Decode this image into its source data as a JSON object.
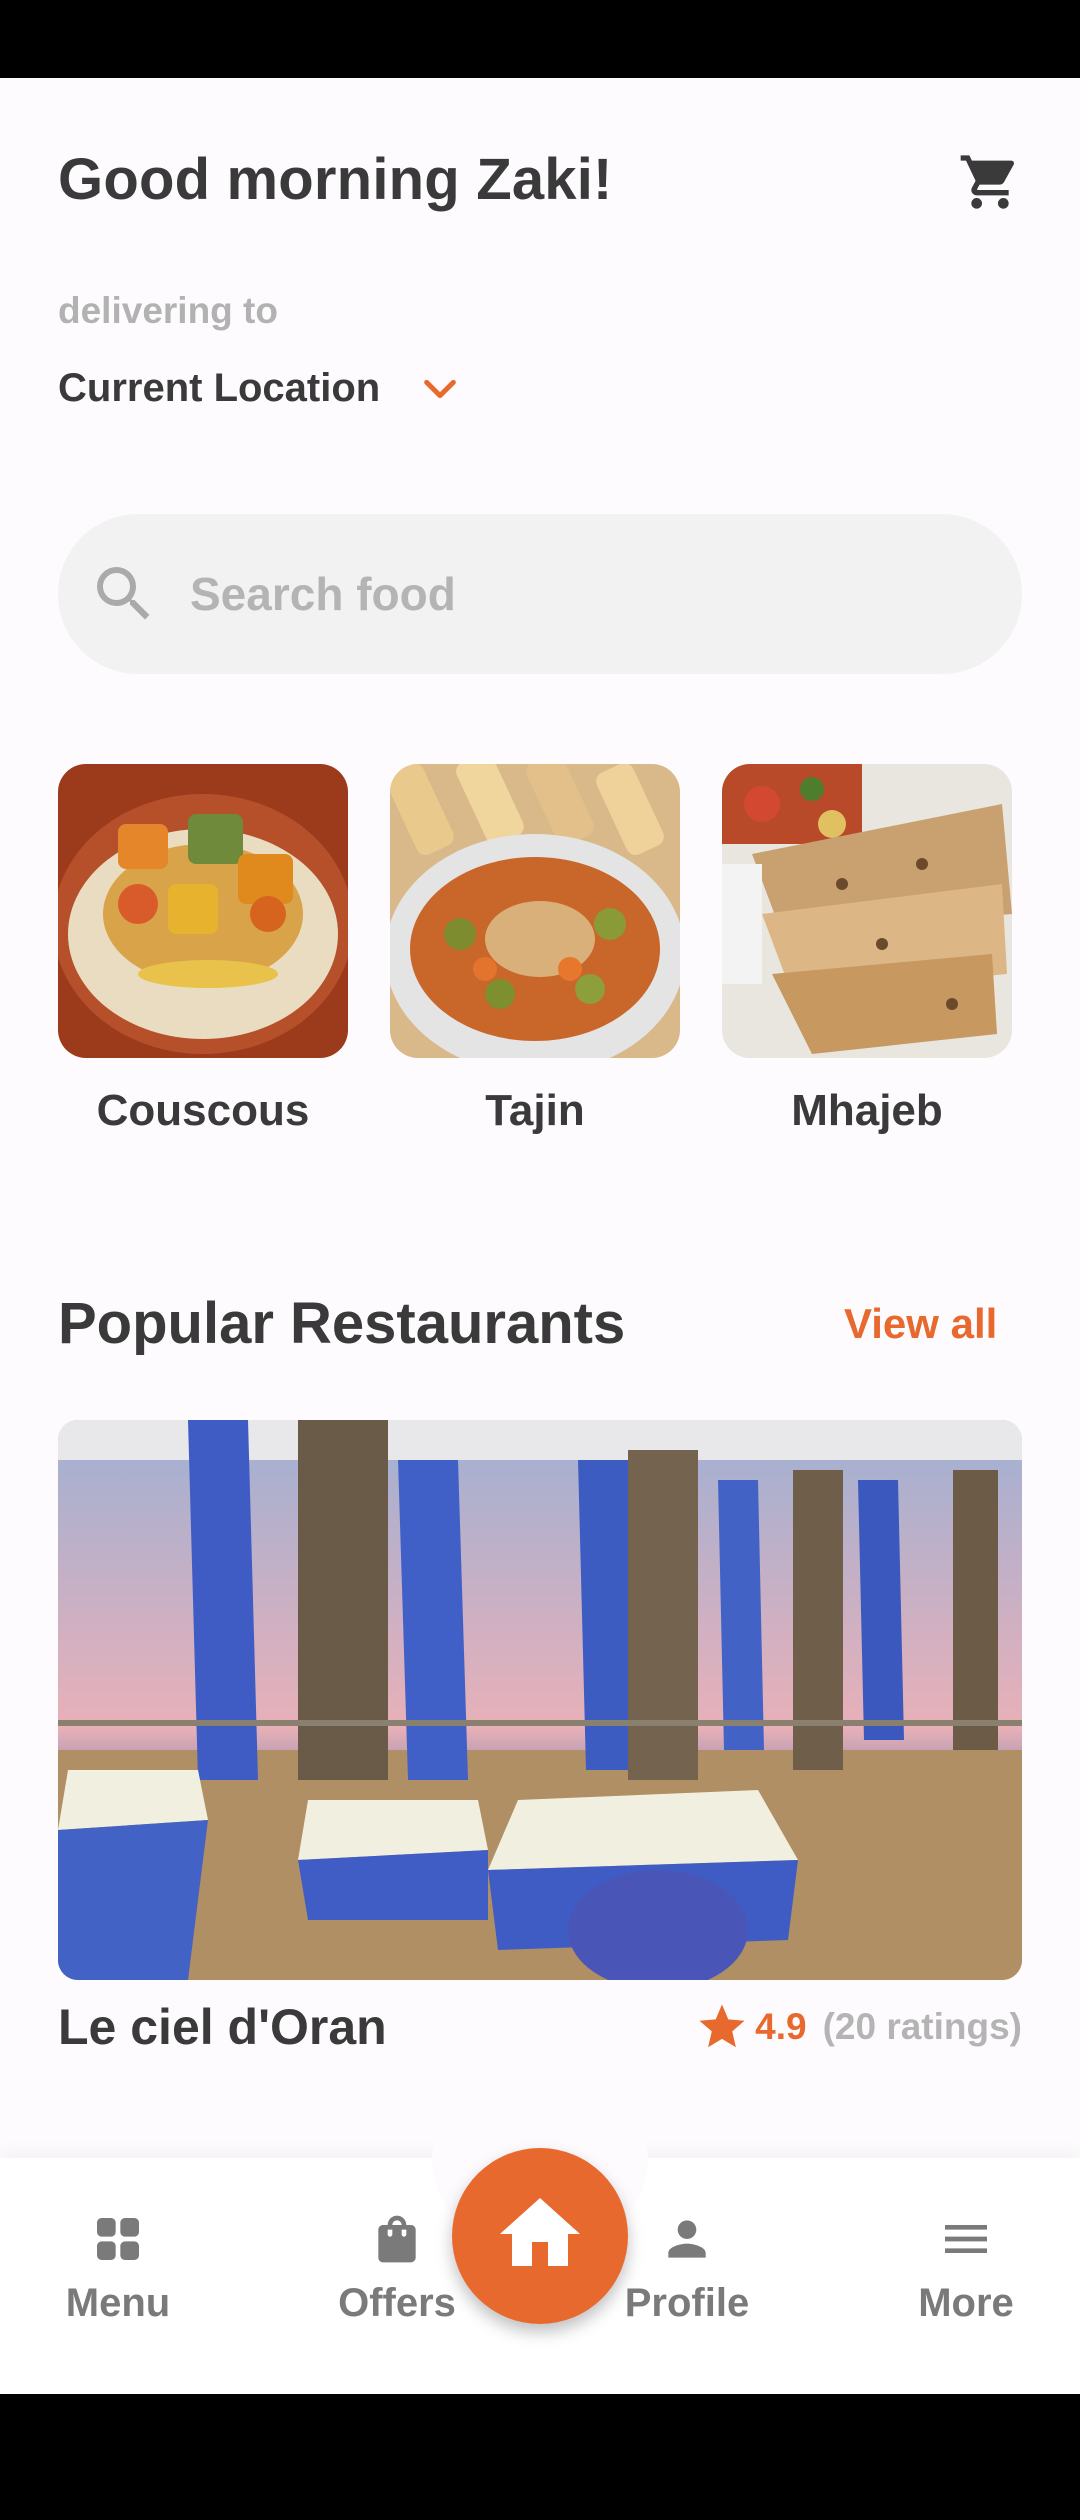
{
  "header": {
    "greeting": "Good morning Zaki!",
    "cart_icon": "cart-icon"
  },
  "delivery": {
    "label": "delivering to",
    "location": "Current Location",
    "chevron_icon": "chevron-down-icon"
  },
  "search": {
    "placeholder": "Search food",
    "value": "",
    "icon": "search-icon"
  },
  "categories": [
    {
      "label": "Couscous"
    },
    {
      "label": "Tajin"
    },
    {
      "label": "Mhajeb"
    }
  ],
  "popular": {
    "title": "Popular Restaurants",
    "view_all": "View all",
    "restaurant": {
      "name": "Le ciel d'Oran",
      "rating": "4.9",
      "ratings_count": "(20 ratings)"
    }
  },
  "bottom_nav": {
    "items": [
      {
        "label": "Menu",
        "icon": "grid-icon"
      },
      {
        "label": "Offers",
        "icon": "shopping-bag-icon"
      },
      {
        "label": "Profile",
        "icon": "person-icon"
      },
      {
        "label": "More",
        "icon": "hamburger-menu-icon"
      }
    ],
    "home_icon": "home-icon"
  },
  "colors": {
    "accent": "#e8692e",
    "text": "#3a3a3a",
    "muted": "#b4b4b4",
    "search_bg": "#f2f2f2"
  }
}
